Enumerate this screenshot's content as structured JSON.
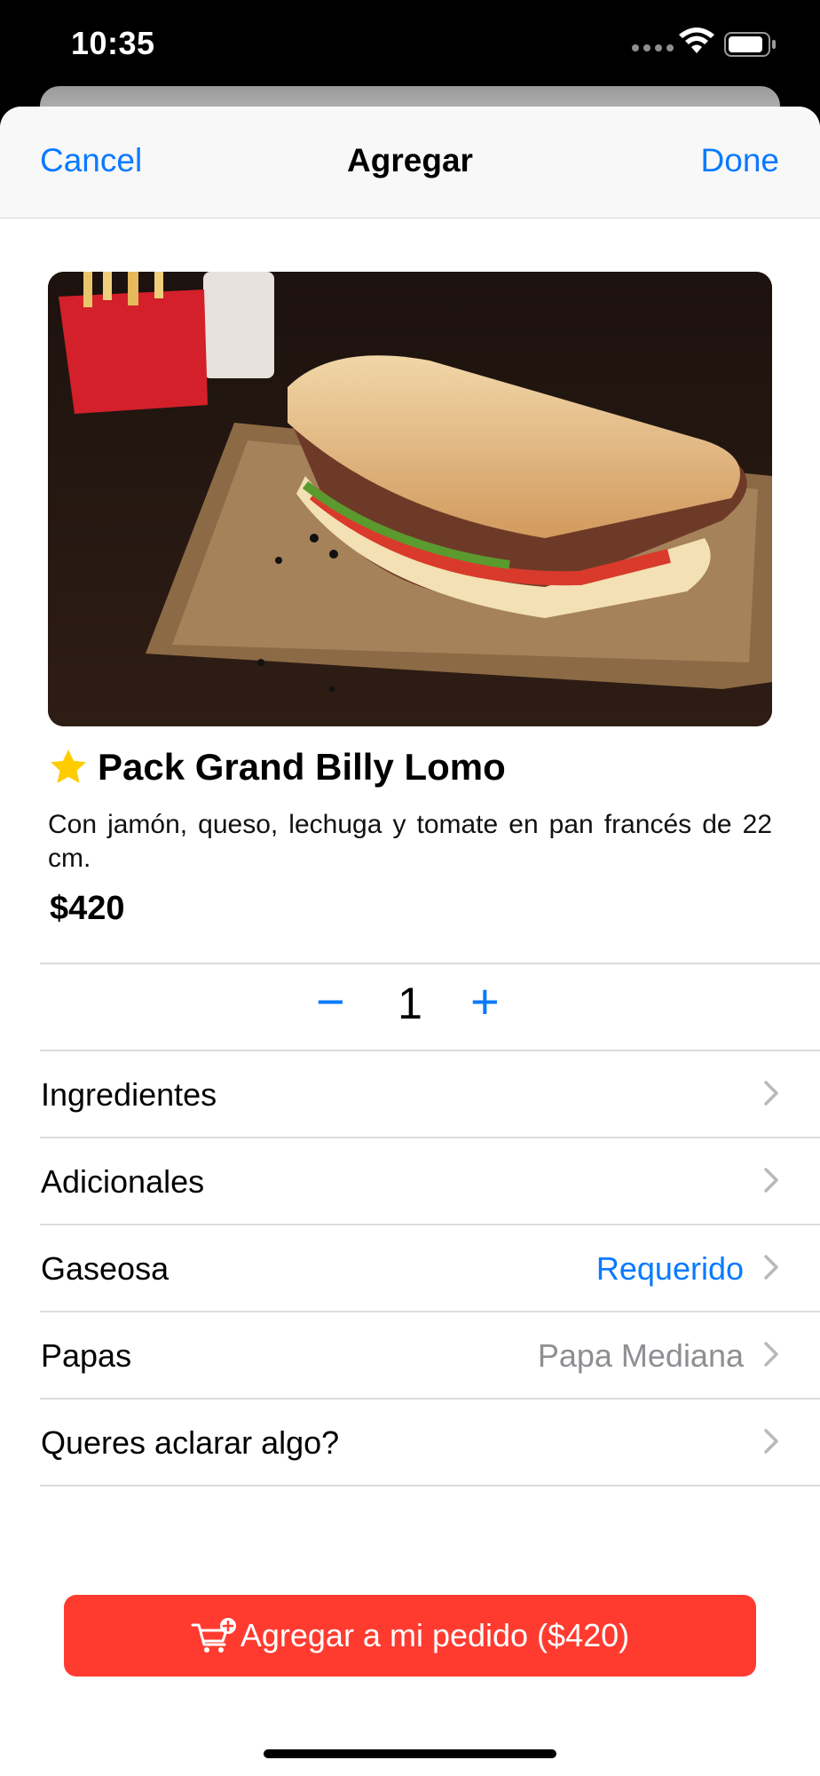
{
  "status_bar": {
    "time": "10:35"
  },
  "navbar": {
    "cancel_label": "Cancel",
    "title": "Agregar",
    "done_label": "Done"
  },
  "product": {
    "name": "Pack Grand Billy Lomo",
    "description": "Con jamón, queso, lechuga y tomate en pan francés de 22 cm.",
    "price": "$420",
    "image_alt": "Pack Grand Billy Lomo"
  },
  "quantity": {
    "minus_label": "−",
    "value": "1",
    "plus_label": "+"
  },
  "options": [
    {
      "label": "Ingredientes",
      "value": ""
    },
    {
      "label": "Adicionales",
      "value": ""
    },
    {
      "label": "Gaseosa",
      "value": "Requerido"
    },
    {
      "label": "Papas",
      "value": "Papa Mediana"
    },
    {
      "label": "Queres aclarar algo?",
      "value": ""
    }
  ],
  "cta": {
    "label": "Agregar a mi pedido ($420)"
  },
  "colors": {
    "accent": "#0a7aff",
    "cta": "#ff3b30",
    "star": "#ffcc00"
  },
  "icons": [
    "star-icon",
    "chevron-right-icon",
    "cart-plus-icon",
    "wifi-icon",
    "battery-icon"
  ]
}
